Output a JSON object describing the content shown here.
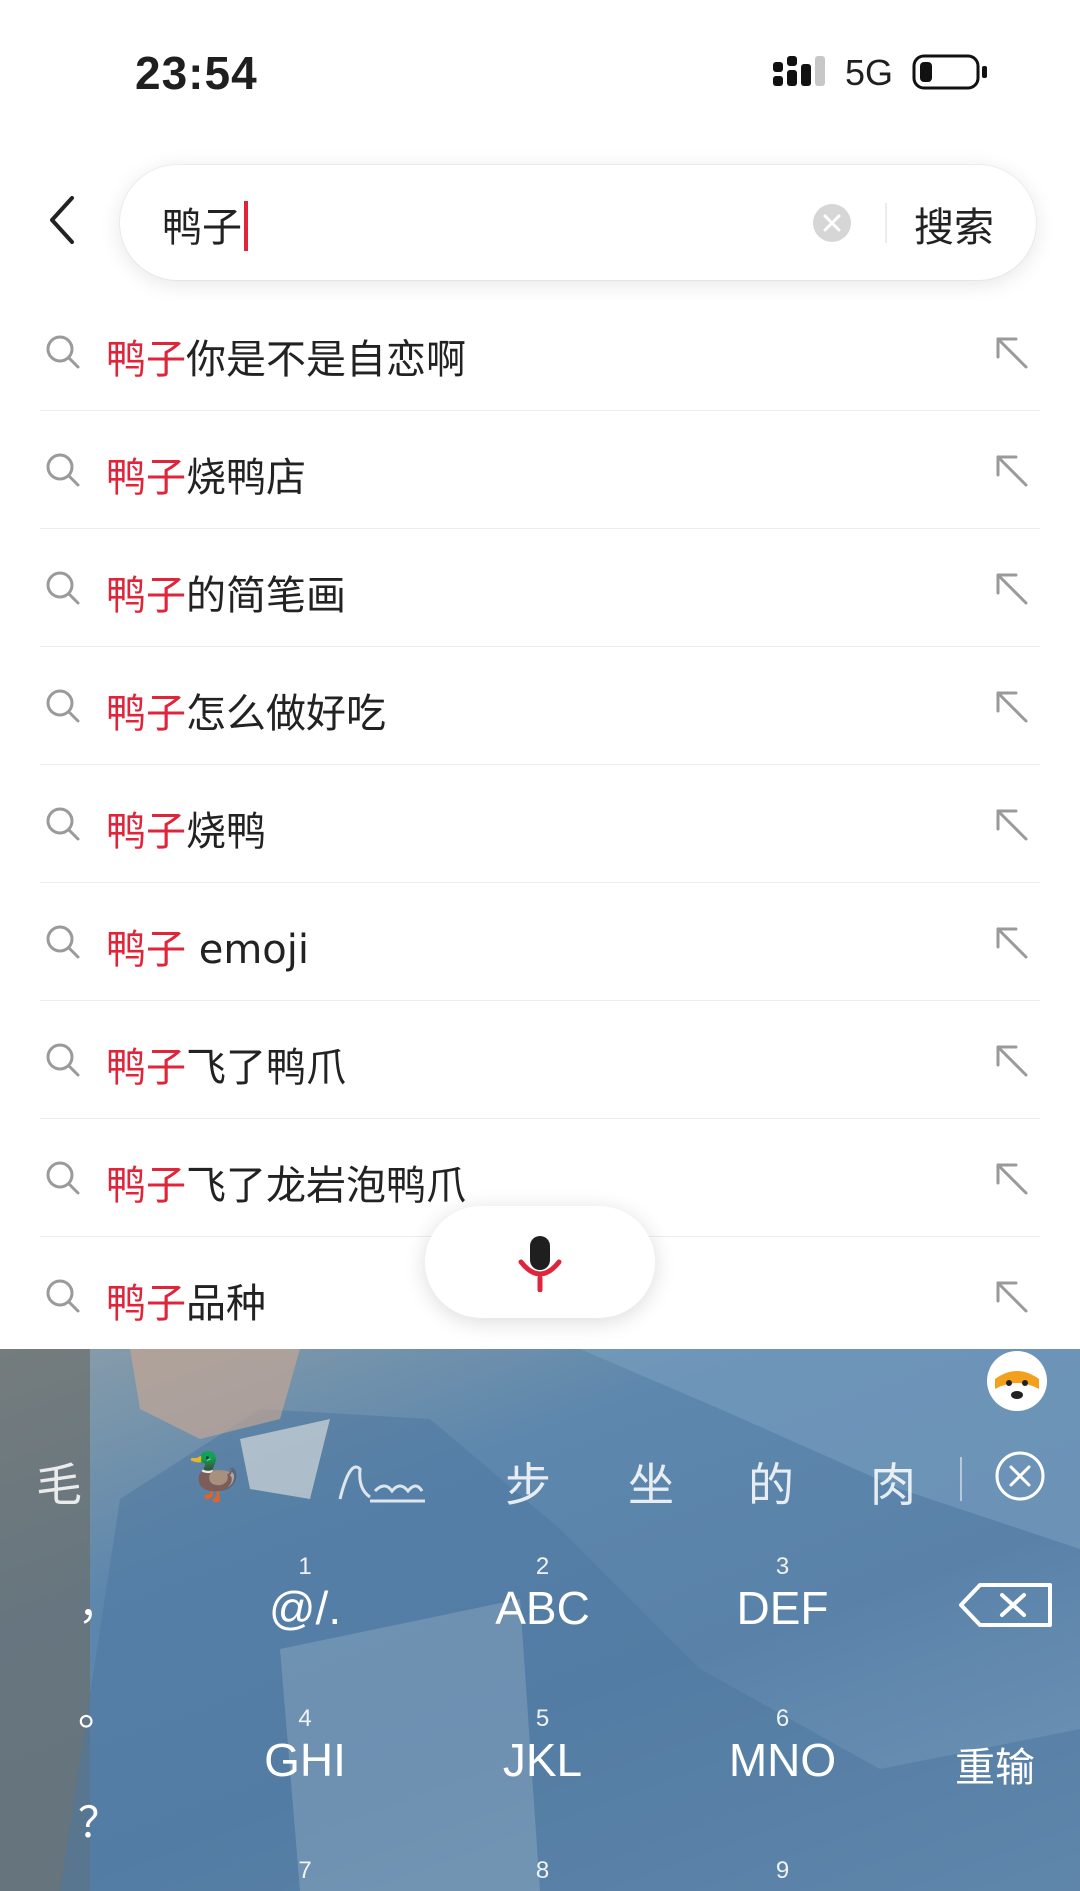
{
  "status": {
    "time": "23:54",
    "network": "5G"
  },
  "search": {
    "query": "鸭子",
    "button_label": "搜索"
  },
  "suggestions": [
    {
      "highlight": "鸭子",
      "rest": "你是不是自恋啊"
    },
    {
      "highlight": "鸭子",
      "rest": "烧鸭店"
    },
    {
      "highlight": "鸭子",
      "rest": "的简笔画"
    },
    {
      "highlight": "鸭子",
      "rest": "怎么做好吃"
    },
    {
      "highlight": "鸭子",
      "rest": "烧鸭"
    },
    {
      "highlight": "鸭子",
      "rest": " emoji"
    },
    {
      "highlight": "鸭子",
      "rest": "飞了鸭爪"
    },
    {
      "highlight": "鸭子",
      "rest": "飞了龙岩泡鸭爪"
    },
    {
      "highlight": "鸭子",
      "rest": "品种"
    }
  ],
  "keyboard": {
    "candidates": [
      "毛",
      "🦆",
      "步",
      "坐",
      "的",
      "肉"
    ],
    "keys": [
      {
        "num": "1",
        "label": "@/."
      },
      {
        "num": "2",
        "label": "ABC"
      },
      {
        "num": "3",
        "label": "DEF"
      },
      {
        "num": "4",
        "label": "GHI"
      },
      {
        "num": "5",
        "label": "JKL"
      },
      {
        "num": "6",
        "label": "MNO"
      },
      {
        "num": "7",
        "label": ""
      },
      {
        "num": "8",
        "label": ""
      },
      {
        "num": "9",
        "label": ""
      }
    ],
    "punctuation": [
      "，",
      "。",
      "？"
    ],
    "retype_label": "重输"
  },
  "colors": {
    "accent": "#e0243a",
    "text": "#222222",
    "divider": "#ededed"
  }
}
